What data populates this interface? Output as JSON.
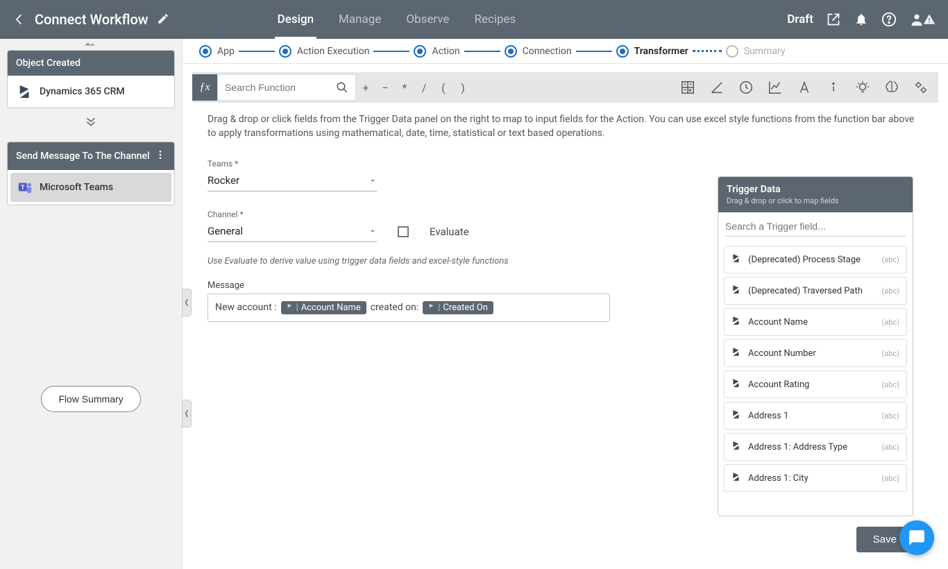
{
  "header": {
    "title": "Connect Workflow",
    "tabs": [
      "Design",
      "Manage",
      "Observe",
      "Recipes"
    ],
    "active_tab": 0,
    "status": "Draft"
  },
  "left_panel": {
    "trigger_card": {
      "title": "Object Created",
      "app": "Dynamics 365 CRM"
    },
    "action_card": {
      "title": "Send Message To The Channel",
      "app": "Microsoft Teams"
    },
    "summary_button": "Flow Summary"
  },
  "steps": {
    "items": [
      "App",
      "Action Execution",
      "Action",
      "Connection",
      "Transformer",
      "Summary"
    ],
    "active_index": 4
  },
  "fn_bar": {
    "search_placeholder": "Search Function",
    "operators": [
      "+",
      "−",
      "*",
      "/",
      "(",
      ")"
    ]
  },
  "instruction": "Drag & drop or click fields from the Trigger Data panel on the right to map to input fields for the Action. You can use excel style functions from the function bar above to apply transformations using mathematical, date, time, statistical or text based operations.",
  "form": {
    "teams_label": "Teams *",
    "teams_value": "Rocker",
    "channel_label": "Channel *",
    "channel_value": "General",
    "evaluate_label": "Evaluate",
    "evaluate_hint": "Use Evaluate to derive value using trigger data fields and excel-style functions",
    "message_label": "Message",
    "message_parts": {
      "p1": "New account :",
      "t1": "Account Name",
      "p2": "created on:",
      "t2": "Created On"
    }
  },
  "trigger_data": {
    "title": "Trigger Data",
    "subtitle": "Drag & drop or click to map fields",
    "search_placeholder": "Search a Trigger field...",
    "fields": [
      {
        "name": "(Deprecated) Process Stage",
        "type": "(abc)"
      },
      {
        "name": "(Deprecated) Traversed Path",
        "type": "(abc)"
      },
      {
        "name": "Account Name",
        "type": "(abc)"
      },
      {
        "name": "Account Number",
        "type": "(abc)"
      },
      {
        "name": "Account Rating",
        "type": "(abc)"
      },
      {
        "name": "Address 1",
        "type": "(abc)"
      },
      {
        "name": "Address 1: Address Type",
        "type": "(abc)"
      },
      {
        "name": "Address 1: City",
        "type": "(abc)"
      }
    ]
  },
  "save_label": "Save",
  "icons": {
    "dynamics": "dynamics-icon",
    "teams": "teams-icon"
  }
}
